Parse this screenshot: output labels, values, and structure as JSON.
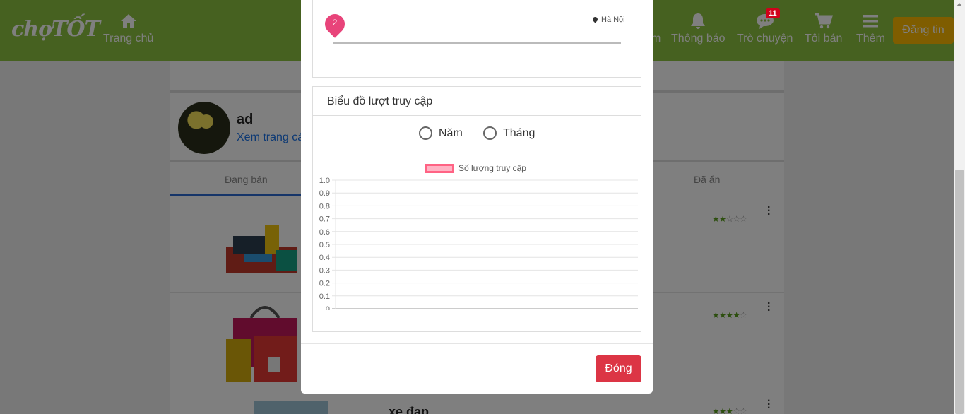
{
  "header": {
    "logo": "chợTỐT",
    "nav": [
      {
        "label": "Trang chủ",
        "icon": "home-icon"
      },
      {
        "label": "m",
        "icon": "none"
      },
      {
        "label": "Thông báo",
        "icon": "bell-icon"
      },
      {
        "label": "Trò chuyện",
        "icon": "chat-icon",
        "badge": "11"
      },
      {
        "label": "Tôi bán",
        "icon": "cart-icon"
      },
      {
        "label": "Thêm",
        "icon": "menu-icon"
      }
    ],
    "post_button": "Đăng tin"
  },
  "profile": {
    "name": "ad",
    "link": "Xem trang cá"
  },
  "tabs": [
    {
      "label": "Đang bán",
      "active": true
    },
    {
      "label": "Đã ẩn",
      "active": false
    }
  ],
  "listings": [
    {
      "rating": 2,
      "title": ""
    },
    {
      "rating": 4,
      "title": ""
    },
    {
      "rating": 3,
      "title": "xe đạp"
    }
  ],
  "modal": {
    "map": {
      "pin_label": "2",
      "location": "Hà Nội"
    },
    "chart_title": "Biểu đồ lượt truy cập",
    "radio_options": [
      "Năm",
      "Tháng"
    ],
    "close_button": "Đóng"
  },
  "chart_data": {
    "type": "line",
    "series": [
      {
        "name": "Số lượng truy cập",
        "values": []
      }
    ],
    "yticks": [
      "1.0",
      "0.9",
      "0.8",
      "0.7",
      "0.6",
      "0.5",
      "0.4",
      "0.3",
      "0.2",
      "0.1",
      "0"
    ],
    "ylim": [
      0,
      1
    ],
    "grid": true,
    "legend_position": "top",
    "colors": {
      "series_fill": "#ffb3c4",
      "series_border": "#ff6384"
    }
  },
  "colors": {
    "header": "#8cc341",
    "post_button": "#ffba00",
    "close_button": "#dc3545",
    "pin": "#e8447a"
  }
}
